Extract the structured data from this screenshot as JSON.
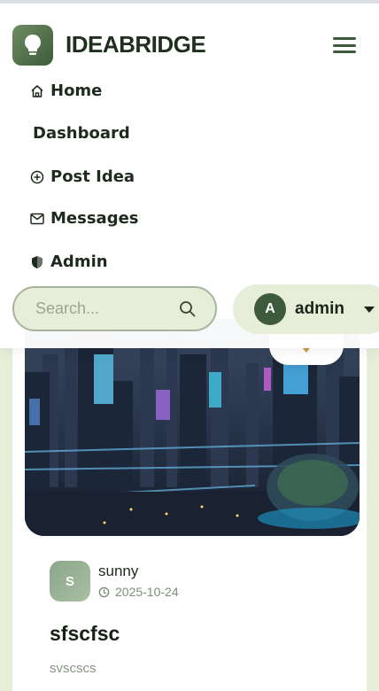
{
  "brand": {
    "name": "IDEABRIDGE"
  },
  "nav": {
    "items": [
      {
        "label": "Home",
        "icon": "home-icon"
      },
      {
        "label": "Dashboard",
        "icon": ""
      },
      {
        "label": "Post Idea",
        "icon": "plus-circle-icon"
      },
      {
        "label": "Messages",
        "icon": "envelope-icon"
      },
      {
        "label": "Admin",
        "icon": "shield-icon"
      }
    ]
  },
  "search": {
    "placeholder": "Search...",
    "value": ""
  },
  "user": {
    "initial": "A",
    "name": "admin"
  },
  "post": {
    "author_initial": "S",
    "author": "sunny",
    "date": "2025-10-24",
    "title": "sfscfsc",
    "description": "svscscs"
  },
  "colors": {
    "accent": "#3d5a3a",
    "page_background": "#e6edd9",
    "search_border": "#a6b49c"
  }
}
